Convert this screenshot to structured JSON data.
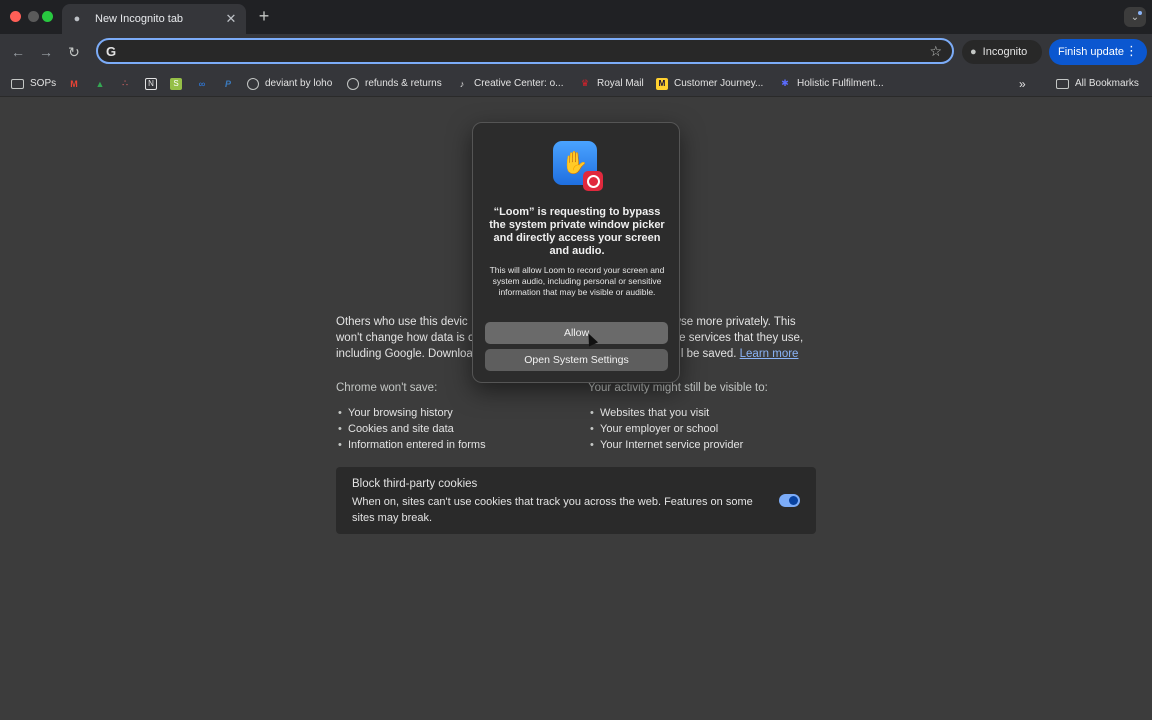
{
  "tab": {
    "title": "New Incognito tab"
  },
  "toolbar": {
    "incognito_label": "Incognito",
    "finish_update_label": "Finish update"
  },
  "bookmarks": [
    {
      "label": "SOPs",
      "icon": "folder-icon"
    },
    {
      "label": "",
      "icon": "gmail-icon"
    },
    {
      "label": "",
      "icon": "google-drive-icon"
    },
    {
      "label": "",
      "icon": "asana-icon"
    },
    {
      "label": "",
      "icon": "notion-icon"
    },
    {
      "label": "",
      "icon": "shopify-icon"
    },
    {
      "label": "",
      "icon": "meta-icon"
    },
    {
      "label": "",
      "icon": "paypal-icon"
    },
    {
      "label": "deviant by loho",
      "icon": "globe-icon"
    },
    {
      "label": "refunds & returns",
      "icon": "globe-icon"
    },
    {
      "label": "Creative Center: o...",
      "icon": "tiktok-icon"
    },
    {
      "label": "Royal Mail",
      "icon": "royal-mail-icon"
    },
    {
      "label": "Customer Journey...",
      "icon": "miro-icon"
    },
    {
      "label": "Holistic Fulfilment...",
      "icon": "puzzle-icon"
    }
  ],
  "bookmarks_overflow": "»",
  "all_bookmarks_label": "All Bookmarks",
  "page": {
    "intro_line1_a": "Others who use this devic",
    "intro_line1_b": "wse more privately. This",
    "intro_line2_a": "won't change how data is c",
    "intro_line2_b": "he services that they use,",
    "intro_line3_a": "including Google. Downloa",
    "intro_line3_b": "l be saved.",
    "learn_more": "Learn more",
    "wont_save_heading": "Chrome won't save:",
    "wont_save_items": [
      "Your browsing history",
      "Cookies and site data",
      "Information entered in forms"
    ],
    "visible_heading": "Your activity might still be visible to:",
    "visible_items": [
      "Websites that you visit",
      "Your employer or school",
      "Your Internet service provider"
    ],
    "cookies_title": "Block third-party cookies",
    "cookies_desc": "When on, sites can't use cookies that track you across the web. Features on some sites may break."
  },
  "dialog": {
    "title": "“Loom” is requesting to bypass the system private window picker and directly access your screen and audio.",
    "body": "This will allow Loom to record your screen and system audio, including personal or sensitive information that may be visible or audible.",
    "allow_label": "Allow",
    "settings_label": "Open System Settings"
  }
}
